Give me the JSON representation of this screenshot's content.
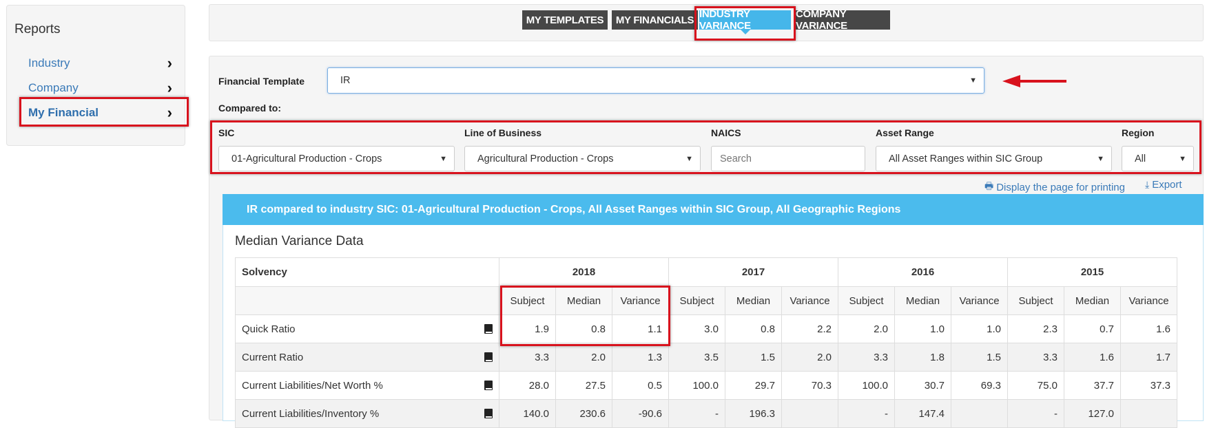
{
  "sidebar": {
    "title": "Reports",
    "items": [
      {
        "label": "Industry"
      },
      {
        "label": "Company"
      },
      {
        "label": "My Financial"
      }
    ]
  },
  "tabs": [
    {
      "label": "MY TEMPLATES"
    },
    {
      "label": "MY FINANCIALS"
    },
    {
      "label": "INDUSTRY VARIANCE"
    },
    {
      "label": "COMPANY VARIANCE"
    }
  ],
  "form": {
    "template_label": "Financial Template",
    "template_value": "IR",
    "compared_to_label": "Compared to:",
    "sic_label": "SIC",
    "sic_value": "01-Agricultural Production - Crops",
    "lob_label": "Line of Business",
    "lob_value": "Agricultural Production - Crops",
    "naics_label": "NAICS",
    "naics_placeholder": "Search",
    "asset_label": "Asset Range",
    "asset_value": "All Asset Ranges within SIC Group",
    "region_label": "Region",
    "region_value": "All"
  },
  "actions": {
    "print": "Display the page for printing",
    "export": "Export"
  },
  "report": {
    "header": "IR compared to industry SIC: 01-Agricultural Production - Crops, All Asset Ranges within SIC Group, All Geographic Regions",
    "subtitle": "Median Variance Data",
    "section": "Solvency",
    "years": [
      "2018",
      "2017",
      "2016",
      "2015"
    ],
    "subcols": [
      "Subject",
      "Median",
      "Variance"
    ],
    "rows": [
      {
        "name": "Quick Ratio",
        "cells": [
          "1.9",
          "0.8",
          "1.1",
          "3.0",
          "0.8",
          "2.2",
          "2.0",
          "1.0",
          "1.0",
          "2.3",
          "0.7",
          "1.6"
        ]
      },
      {
        "name": "Current Ratio",
        "cells": [
          "3.3",
          "2.0",
          "1.3",
          "3.5",
          "1.5",
          "2.0",
          "3.3",
          "1.8",
          "1.5",
          "3.3",
          "1.6",
          "1.7"
        ]
      },
      {
        "name": "Current Liabilities/Net Worth %",
        "cells": [
          "28.0",
          "27.5",
          "0.5",
          "100.0",
          "29.7",
          "70.3",
          "100.0",
          "30.7",
          "69.3",
          "75.0",
          "37.7",
          "37.3"
        ]
      },
      {
        "name": "Current Liabilities/Inventory %",
        "cells": [
          "140.0",
          "230.6",
          "-90.6",
          "-",
          "196.3",
          "",
          "-",
          "147.4",
          "",
          "-",
          "127.0",
          ""
        ]
      }
    ]
  },
  "colors": {
    "accent": "#45b6ea",
    "tab_dark": "#474747",
    "link": "#3a7ab8",
    "highlight": "#d8121d"
  }
}
